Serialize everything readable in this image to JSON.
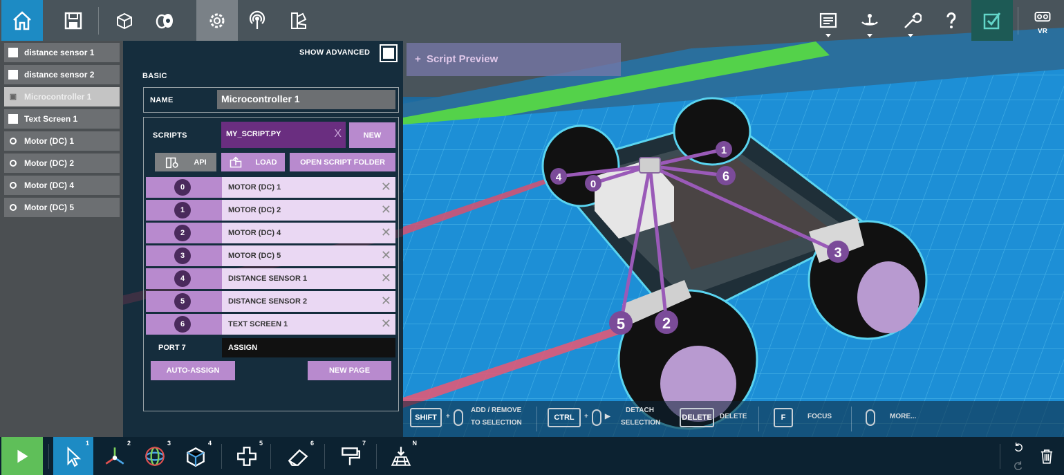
{
  "top_toolbar": {
    "vr_label": "VR"
  },
  "parts": [
    {
      "label": "distance sensor 1",
      "icon": "square-icon"
    },
    {
      "label": "distance sensor 2",
      "icon": "square-icon"
    },
    {
      "label": "Microcontroller 1",
      "icon": "chip-icon",
      "selected": true
    },
    {
      "label": "Text Screen 1",
      "icon": "square-icon"
    },
    {
      "label": "Motor (DC) 1",
      "icon": "circle-icon"
    },
    {
      "label": "Motor (DC) 2",
      "icon": "circle-icon"
    },
    {
      "label": "Motor (DC) 4",
      "icon": "circle-icon"
    },
    {
      "label": "Motor (DC) 5",
      "icon": "circle-icon"
    }
  ],
  "props": {
    "show_advanced_label": "SHOW ADVANCED",
    "basic_label": "BASIC",
    "name_label": "NAME",
    "name_value": "Microcontroller 1",
    "scripts_label": "SCRIPTS",
    "script_file": "MY_SCRIPT.PY",
    "script_remove": "X",
    "new_label": "NEW",
    "api_label": "API",
    "load_label": "LOAD",
    "open_folder_label": "OPEN SCRIPT FOLDER",
    "ports": [
      {
        "num": "0",
        "name": "MOTOR (DC) 1"
      },
      {
        "num": "1",
        "name": "MOTOR (DC) 2"
      },
      {
        "num": "2",
        "name": "MOTOR (DC) 4"
      },
      {
        "num": "3",
        "name": "MOTOR (DC) 5"
      },
      {
        "num": "4",
        "name": "DISTANCE SENSOR 1"
      },
      {
        "num": "5",
        "name": "DISTANCE SENSOR 2"
      },
      {
        "num": "6",
        "name": "TEXT SCREEN 1"
      }
    ],
    "port7_label": "PORT 7",
    "port7_assign": "ASSIGN",
    "auto_assign_label": "AUTO-ASSIGN",
    "new_page_label": "NEW PAGE"
  },
  "script_preview": {
    "label": "Script Preview"
  },
  "hints": {
    "shift": "SHIFT",
    "add_remove_1": "ADD / REMOVE",
    "add_remove_2": "TO SELECTION",
    "ctrl": "CTRL",
    "detach_1": "DETACH",
    "detach_2": "SELECTION",
    "delete_key": "DELETE",
    "delete_txt": "DELETE",
    "f_key": "F",
    "focus": "FOCUS",
    "more": "MORE..."
  },
  "scene_labels": [
    "0",
    "1",
    "2",
    "3",
    "4",
    "5",
    "6"
  ],
  "bottom_toolbar": {
    "tools": [
      {
        "num": "1",
        "icon": "select-arrow-icon"
      },
      {
        "num": "2",
        "icon": "move-axes-icon"
      },
      {
        "num": "3",
        "icon": "rotate-icon"
      },
      {
        "num": "4",
        "icon": "scale-cube-icon"
      },
      {
        "num": "5",
        "icon": "add-part-icon"
      },
      {
        "num": "6",
        "icon": "eraser-icon"
      },
      {
        "num": "7",
        "icon": "paint-roller-icon"
      },
      {
        "num": "N",
        "icon": "place-on-grid-icon"
      }
    ]
  },
  "colors": {
    "accent_blue": "#1d8bc4",
    "purple": "#b88ace",
    "dark_purple": "#6a2e80",
    "play_green": "#5fbf59"
  }
}
